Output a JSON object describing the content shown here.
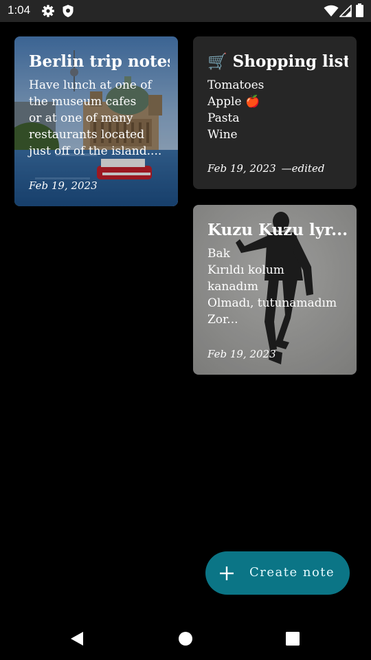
{
  "status_bar": {
    "time": "1:04",
    "icons": [
      "gear-icon",
      "shield-icon",
      "wifi-icon",
      "signal-icon",
      "battery-icon"
    ]
  },
  "notes": [
    {
      "title": "Berlin trip notes",
      "body": "Have lunch at one of\nthe museum cafes\nor at one of many\nrestaurants located\njust off of the island....",
      "date": "Feb 19, 2023",
      "background": "image-berlin-cathedral-river"
    },
    {
      "title": "🛒 Shopping list",
      "body": "Tomatoes\nApple 🍎\nPasta\nWine",
      "date": "Feb 19, 2023",
      "edited_label": "—edited",
      "background": "#262626"
    },
    {
      "title": "Kuzu Kuzu lyr...",
      "body": "Bak\nKırıldı kolum\nkanadım\nOlmadı, tutunamadım\nZor...",
      "date": "Feb 19, 2023",
      "background": "image-man-jumping-grey"
    }
  ],
  "fab": {
    "label": "Create note",
    "icon": "plus-icon",
    "color": "#0b7586"
  },
  "nav_bar": {
    "icons": [
      "back-icon",
      "home-icon",
      "recents-icon"
    ]
  },
  "colors": {
    "background": "#000000",
    "card_dark": "#262626",
    "status_bar": "#262626"
  }
}
